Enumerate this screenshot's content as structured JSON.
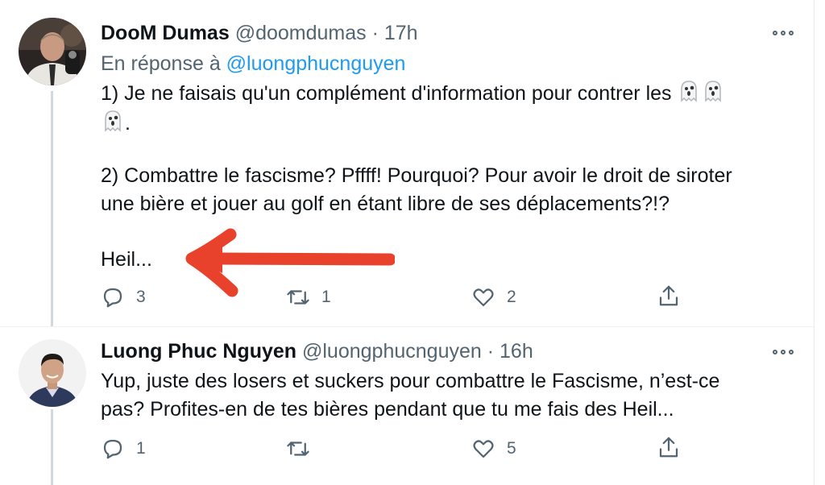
{
  "tweets": [
    {
      "display_name": "DooM Dumas",
      "handle": "@doomdumas",
      "separator": "·",
      "time": "17h",
      "reply_prefix": "En réponse à",
      "reply_handle": "@luongphucnguyen",
      "lines": [
        "1) Je ne faisais qu'un complément d'information pour contrer les",
        ".",
        "2) Combattre le fascisme? Pffff! Pourquoi? Pour avoir le droit de siroter",
        "une bière et jouer au golf en étant libre de ses déplacements?!?",
        "Heil..."
      ],
      "emoji": "ghost-icon",
      "actions": {
        "reply_count": "3",
        "retweet_count": "1",
        "like_count": "2"
      }
    },
    {
      "display_name": "Luong Phuc Nguyen",
      "handle": "@luongphucnguyen",
      "separator": "·",
      "time": "16h",
      "lines": [
        "Yup, juste des losers et suckers pour combattre le Fascisme, n’est-ce",
        "pas?  Profites-en de tes bières pendant que tu me fais des Heil..."
      ],
      "actions": {
        "reply_count": "1",
        "retweet_count": "",
        "like_count": "5"
      }
    }
  ],
  "colors": {
    "link": "#1d9bf0",
    "secondary_text": "#536471",
    "annotation_arrow": "#e8412c",
    "thread_line": "#cfd9de"
  }
}
